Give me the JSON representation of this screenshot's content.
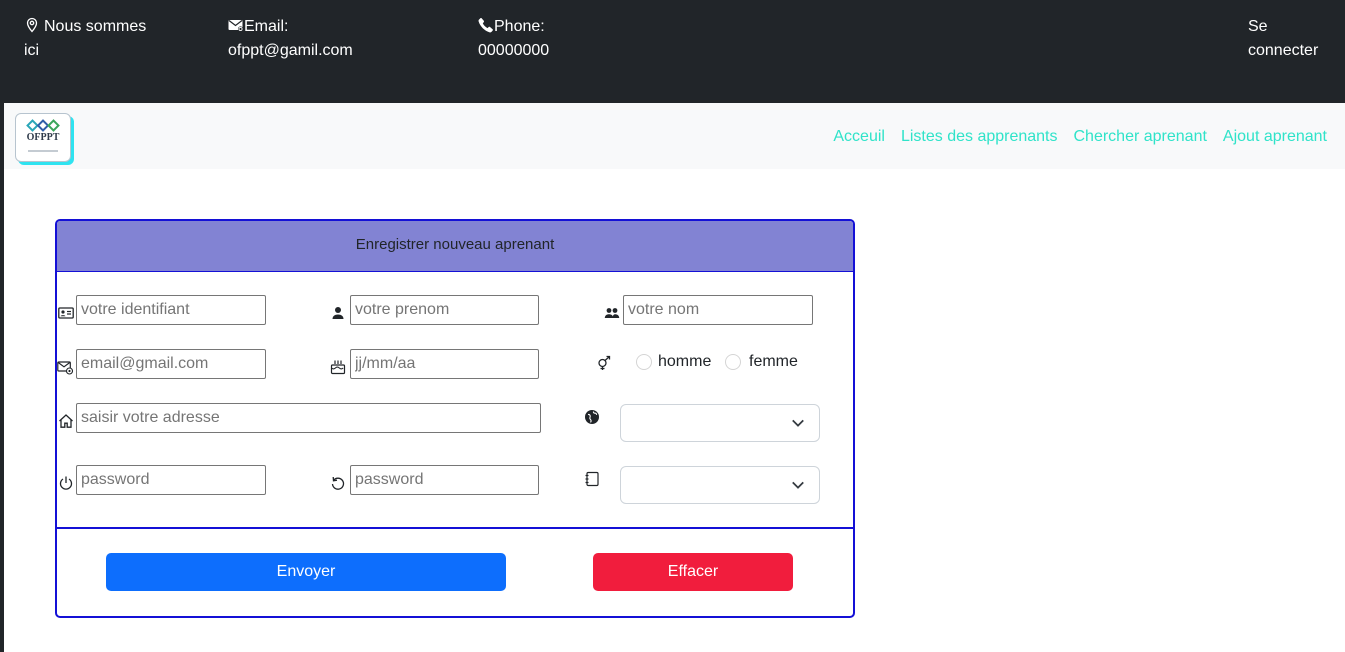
{
  "topbar": {
    "address": {
      "icon": "location-pin-icon",
      "line1": "Nous sommes",
      "line2": "ici"
    },
    "email": {
      "icon": "envelope-icon",
      "label": "Email:",
      "value": "ofppt@gamil.com"
    },
    "phone": {
      "icon": "phone-icon",
      "label": "Phone:",
      "value": "00000000"
    },
    "login": {
      "line1": "Se",
      "line2": "connecter"
    }
  },
  "navbar": {
    "logo_text": "OFPPT",
    "links": [
      "Acceuil",
      "Listes des apprenants",
      "Chercher aprenant",
      "Ajout aprenant"
    ],
    "link_color": "#2fe3c9"
  },
  "form": {
    "title": "Enregistrer nouveau aprenant",
    "fields": {
      "identifiant": {
        "icon": "id-card-icon",
        "placeholder": "votre identifiant",
        "value": ""
      },
      "prenom": {
        "icon": "person-icon",
        "placeholder": "votre prenom",
        "value": ""
      },
      "nom": {
        "icon": "people-icon",
        "placeholder": "votre nom",
        "value": ""
      },
      "email": {
        "icon": "envelope-at-icon",
        "placeholder": "email@gmail.com",
        "value": ""
      },
      "date_naissance": {
        "icon": "cake-icon",
        "placeholder": "jj/mm/aa",
        "value": ""
      },
      "genre": {
        "icon": "gender-icon",
        "options": [
          "homme",
          "femme"
        ],
        "selected": null
      },
      "adresse": {
        "icon": "house-icon",
        "placeholder": "saisir votre adresse",
        "value": ""
      },
      "pays": {
        "icon": "globe-icon",
        "selected": ""
      },
      "password": {
        "icon": "power-icon",
        "placeholder": "password",
        "value": ""
      },
      "password_confirm": {
        "icon": "refresh-icon",
        "placeholder": "password",
        "value": ""
      },
      "filiere": {
        "icon": "notebook-icon",
        "selected": ""
      }
    },
    "buttons": {
      "submit": "Envoyer",
      "reset": "Effacer"
    }
  },
  "colors": {
    "topbar_bg": "#212529",
    "header_bg": "#8283d3",
    "card_border": "#1410d6",
    "primary": "#0d6efd",
    "danger": "#f11d3d"
  }
}
